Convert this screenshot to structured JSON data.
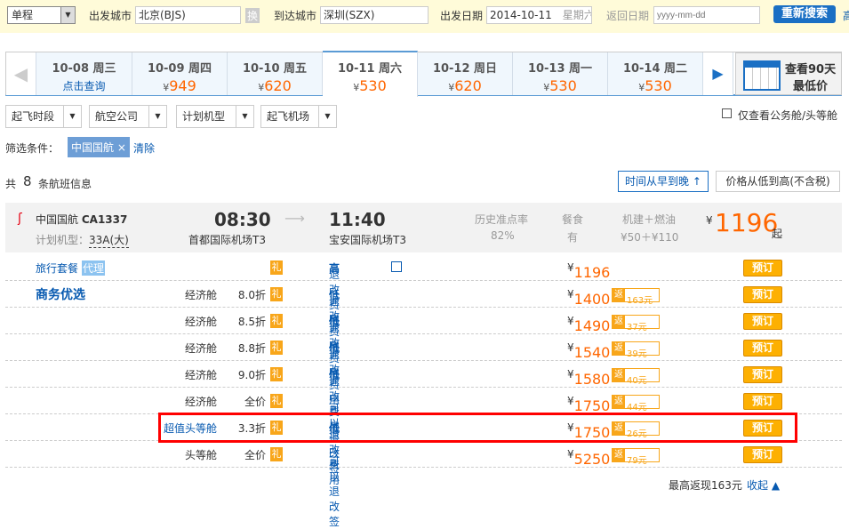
{
  "search": {
    "trip_type": "单程",
    "from_label": "出发城市",
    "from_value": "北京(BJS)",
    "swap": "换",
    "to_label": "到达城市",
    "to_value": "深圳(SZX)",
    "depart_label": "出发日期",
    "depart_value": "2014-10-11",
    "depart_weekday": "星期六",
    "return_label": "返回日期",
    "return_placeholder": "yyyy-mm-dd",
    "search_button": "重新搜索",
    "more": "高"
  },
  "dates": [
    {
      "date": "10-08 周三",
      "price": "点击查询",
      "link": true
    },
    {
      "date": "10-09 周四",
      "price": "949"
    },
    {
      "date": "10-10 周五",
      "price": "620"
    },
    {
      "date": "10-11 周六",
      "price": "530",
      "active": true
    },
    {
      "date": "10-12 周日",
      "price": "620"
    },
    {
      "date": "10-13 周一",
      "price": "530"
    },
    {
      "date": "10-14 周二",
      "price": "530"
    }
  ],
  "currency": "¥",
  "calendar": {
    "line1": "查看90天",
    "line2": "最低价"
  },
  "filters": [
    "起飞时段",
    "航空公司",
    "计划机型",
    "起飞机场"
  ],
  "business_only": "仅查看公务舱/头等舱",
  "filter_cond": {
    "label": "筛选条件：",
    "tag": "中国国航",
    "clear": "清除"
  },
  "count": {
    "pre": "共",
    "num": "8",
    "post": "条航班信息"
  },
  "sort": {
    "time": "时间从早到晚",
    "price": "价格从低到高(不含税)"
  },
  "flight": {
    "airline": "中国国航",
    "number": "CA1337",
    "model_label": "计划机型：",
    "model": "33A(大)",
    "dep_time": "08:30",
    "dep_airport": "首都国际机场T3",
    "arr_time": "11:40",
    "arr_airport": "宝安国际机场T3",
    "ontime_label": "历史准点率",
    "ontime": "82%",
    "meal_label": "餐食",
    "meal": "有",
    "tax_label": "机建＋燃油",
    "tax": "¥50＋¥110",
    "price": "1196",
    "price_suffix": "起"
  },
  "rows": [
    {
      "label": "旅行套餐",
      "badge": "代理",
      "cabin": "",
      "discount": "",
      "refund": "退改费用",
      "refund_level": "高",
      "price": "1196",
      "rebate": "",
      "book": "预订"
    },
    {
      "label": "商务优选",
      "cabin": "经济舱",
      "discount": "8.0折",
      "refund": "退改费用",
      "refund_level": "低",
      "price": "1400",
      "rebate": "163元",
      "book": "预订"
    },
    {
      "cabin": "经济舱",
      "discount": "8.5折",
      "refund": "退改费用",
      "refund_level": "低",
      "price": "1490",
      "rebate": "37元",
      "book": "预订"
    },
    {
      "cabin": "经济舱",
      "discount": "8.8折",
      "refund": "退改费用",
      "refund_level": "低",
      "price": "1540",
      "rebate": "39元",
      "book": "预订"
    },
    {
      "cabin": "经济舱",
      "discount": "9.0折",
      "refund": "退改费用",
      "refund_level": "低",
      "price": "1580",
      "rebate": "40元",
      "book": "预订"
    },
    {
      "cabin": "经济舱",
      "discount": "全价",
      "refund": "可以退改签",
      "refund_level": "",
      "price": "1750",
      "rebate": "44元",
      "book": "预订"
    },
    {
      "cabin": "超值头等舱",
      "discount": "3.3折",
      "refund": "退改费用",
      "refund_level": "低",
      "price": "1750",
      "rebate": "26元",
      "book": "预订",
      "highlight": true
    },
    {
      "cabin": "头等舱",
      "discount": "全价",
      "refund": "可以退改签",
      "refund_level": "",
      "price": "5250",
      "rebate": "79元",
      "book": "预订"
    }
  ],
  "gift": "礼",
  "rebate_prefix": "返",
  "footer": {
    "max_rebate": "最高返现163元",
    "collapse": "收起"
  }
}
